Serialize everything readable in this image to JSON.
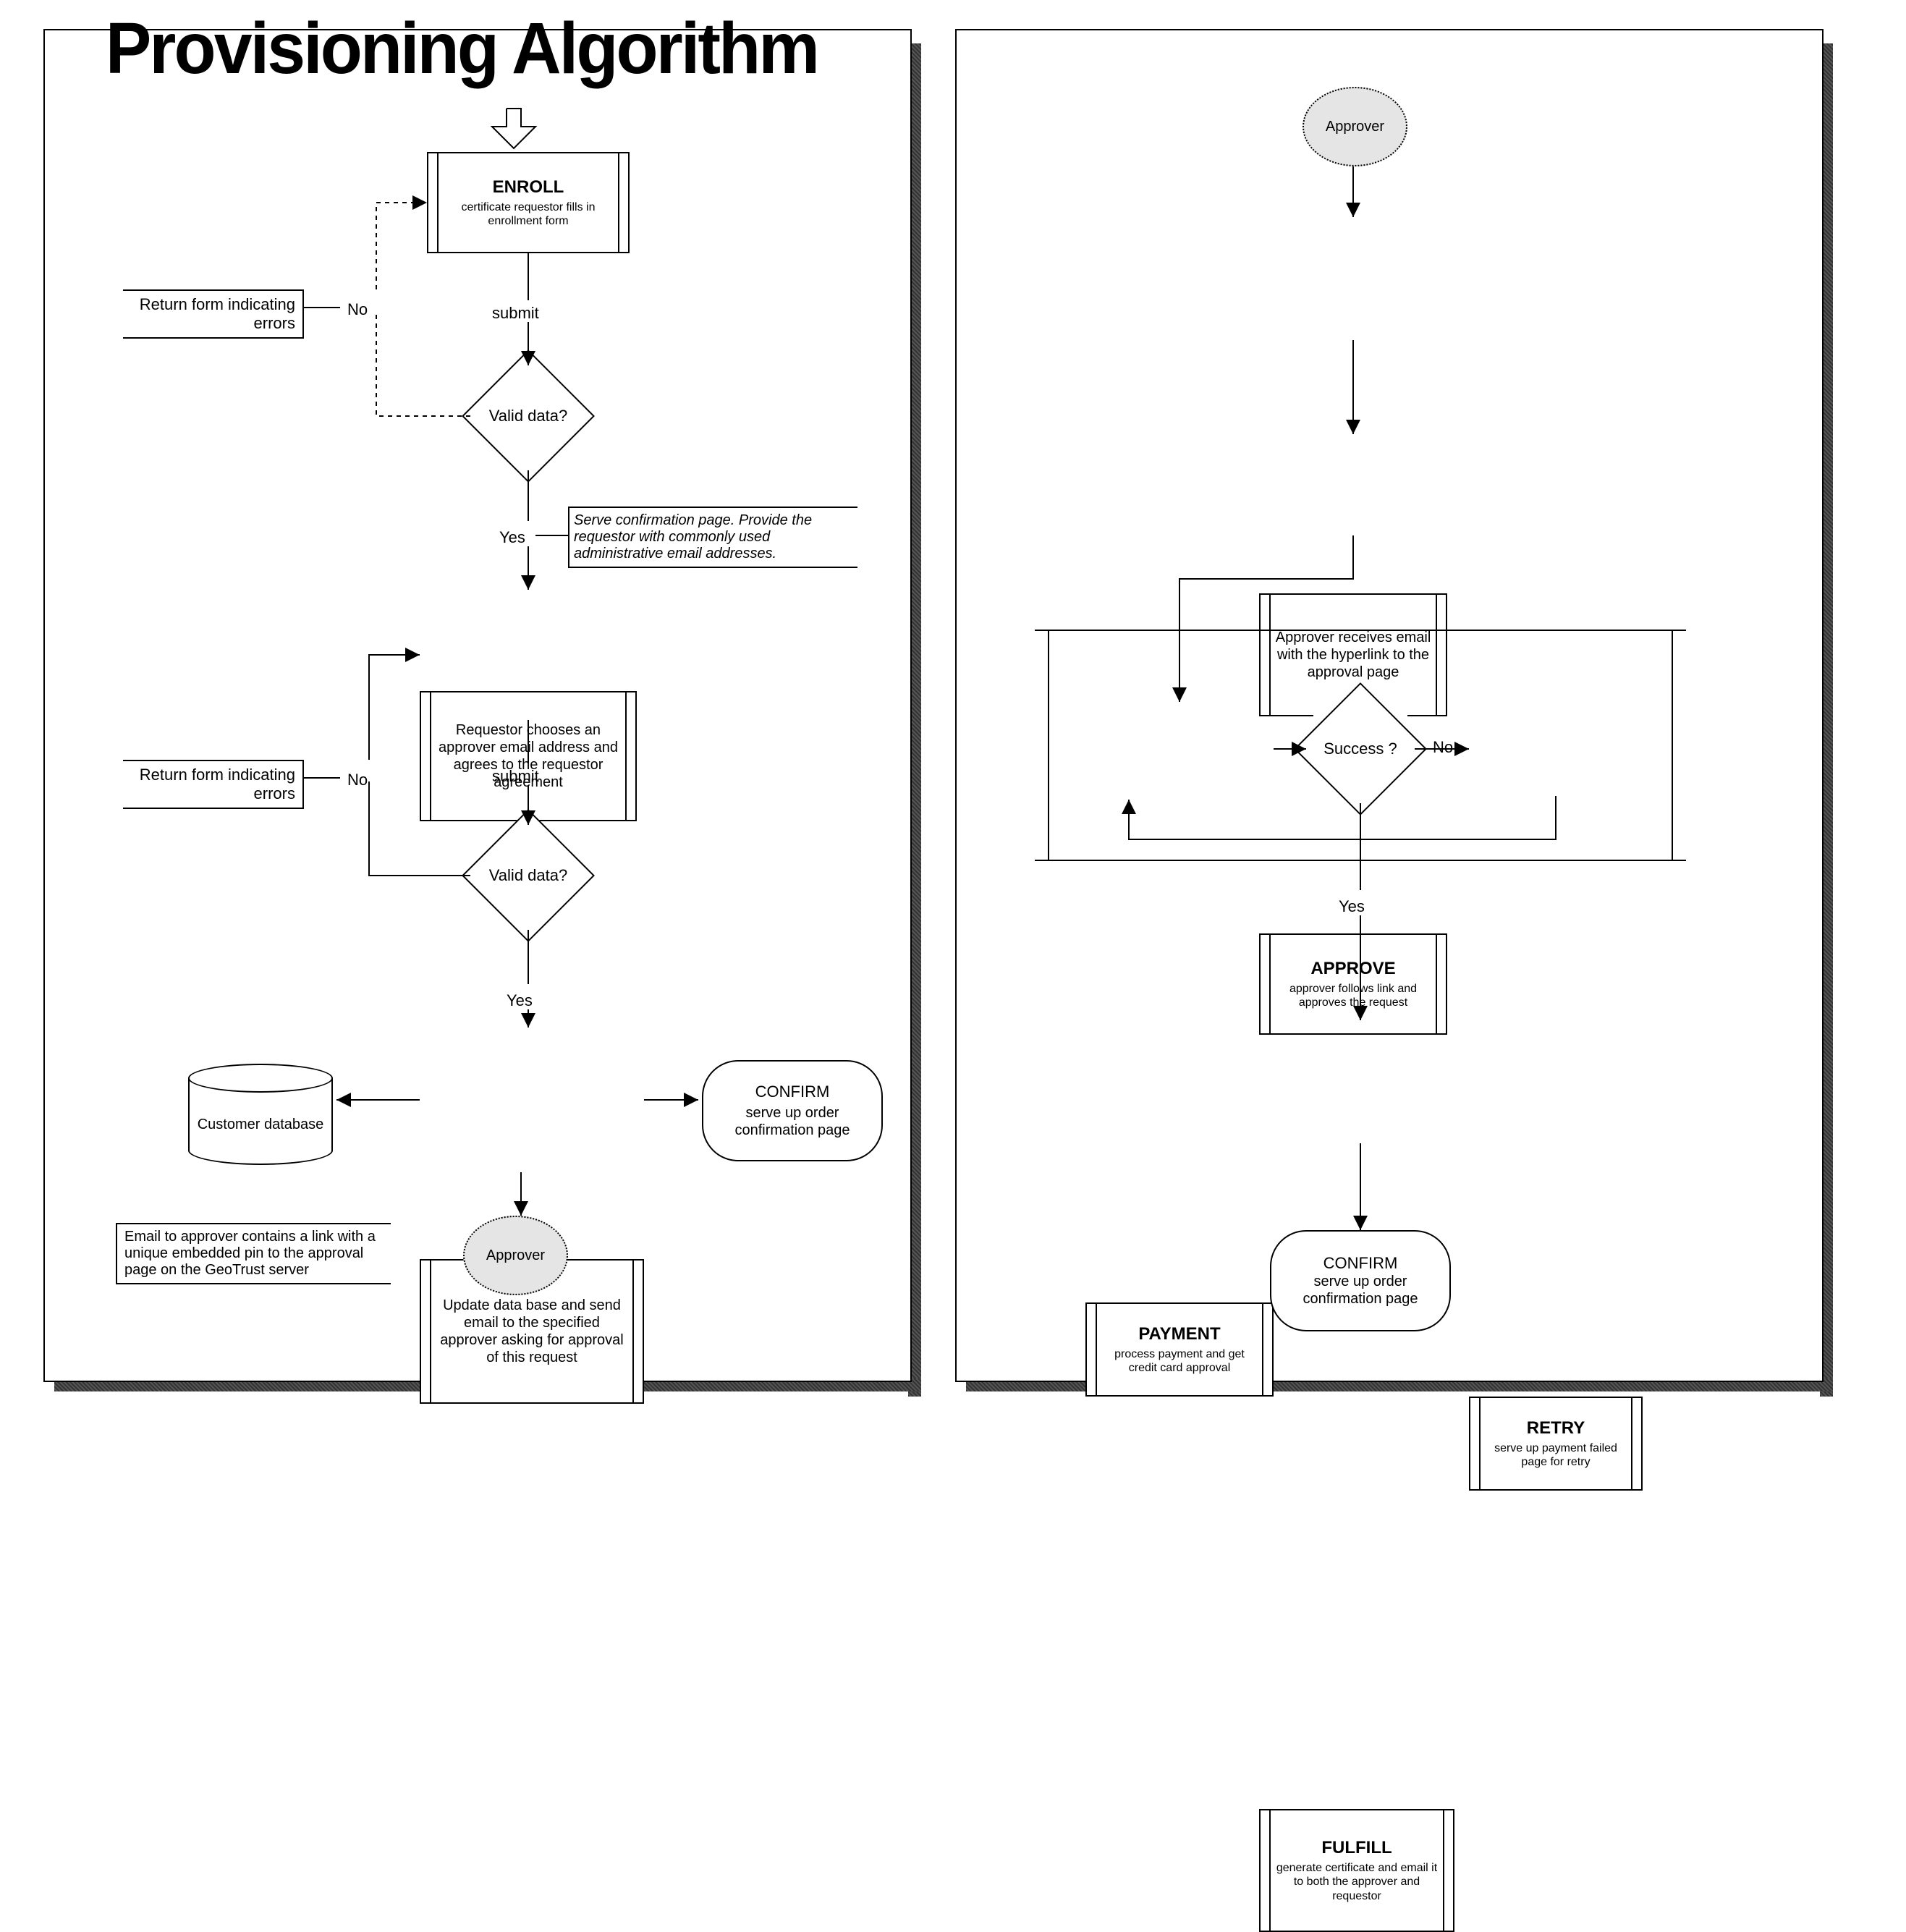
{
  "title": "Provisioning Algorithm",
  "left": {
    "enroll": {
      "heading": "ENROLL",
      "sub": "certificate requestor fills in enrollment form"
    },
    "submit1": "submit",
    "valid1": "Valid data?",
    "no1": "No",
    "yes1": "Yes",
    "return_errors1": "Return form indicating errors",
    "serve_confirm_note": "Serve confirmation page.  Provide the requestor with commonly used administrative email addresses.",
    "choose_approver": "Requestor chooses an approver email address and agrees to the requestor agreement",
    "submit2": "submit",
    "valid2": "Valid data?",
    "no2": "No",
    "yes2": "Yes",
    "return_errors2": "Return form indicating errors",
    "update_db": "Update data base and send email to the specified approver asking for approval of this request",
    "db": "Customer database",
    "confirm": {
      "heading": "CONFIRM",
      "sub": "serve up order confirmation page"
    },
    "approver_terminator": "Approver",
    "email_note": "Email to approver contains a link with a unique embedded pin to the approval page on the GeoTrust server"
  },
  "right": {
    "approver_start": "Approver",
    "approver_receives": "Approver receives email with the hyperlink to the approval page",
    "approve": {
      "heading": "APPROVE",
      "sub": "approver follows link and approves the request"
    },
    "payment": {
      "heading": "PAYMENT",
      "sub": "process payment and get credit card approval"
    },
    "success": "Success ?",
    "no": "No",
    "yes": "Yes",
    "retry": {
      "heading": "RETRY",
      "sub": "serve up payment failed page for retry"
    },
    "fulfill": {
      "heading": "FULFILL",
      "sub": "generate certificate and email it to both the approver and requestor"
    },
    "confirm": {
      "heading": "CONFIRM",
      "sub": "serve up order confirmation page"
    }
  }
}
